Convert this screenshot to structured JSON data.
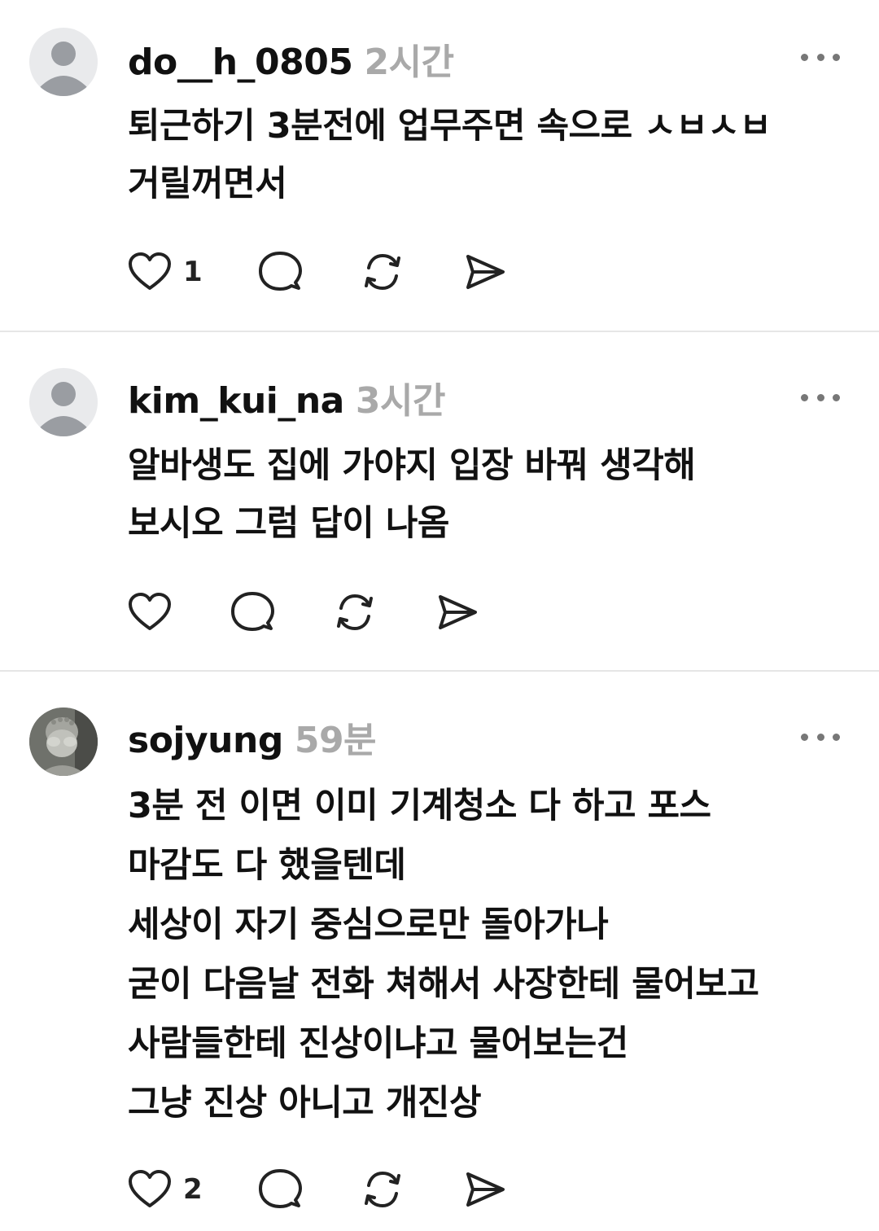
{
  "posts": [
    {
      "username": "do__h_0805",
      "time": "2시간",
      "avatar": "default-avatar",
      "lines": [
        "퇴근하기 3분전에 업무주면 속으로 ㅅㅂㅅㅂ",
        "거릴꺼면서"
      ],
      "like_count": "1"
    },
    {
      "username": "kim_kui_na",
      "time": "3시간",
      "avatar": "default-avatar",
      "lines": [
        "알바생도 집에 가야지 입장 바꿔 생각해",
        "보시오 그럼 답이 나옴"
      ],
      "like_count": ""
    },
    {
      "username": "sojyung",
      "time": "59분",
      "avatar": "buddha-statue-photo",
      "lines": [
        "3분 전 이면 이미 기계청소 다 하고 포스",
        "마감도 다 했을텐데",
        "세상이 자기 중심으로만 돌아가나",
        "굳이 다음날 전화 쳐해서 사장한테 물어보고",
        "사람들한테 진상이냐고 물어보는건",
        "그냥 진상 아니고 개진상"
      ],
      "like_count": "2"
    }
  ],
  "icons": [
    "heart-icon",
    "comment-icon",
    "repost-icon",
    "share-icon",
    "more-icon"
  ],
  "colors": {
    "text": "#111111",
    "muted": "#a9a9a9",
    "divider": "#e6e6e6",
    "avatar_bg": "#e9eaec",
    "avatar_fg": "#9a9da2"
  }
}
